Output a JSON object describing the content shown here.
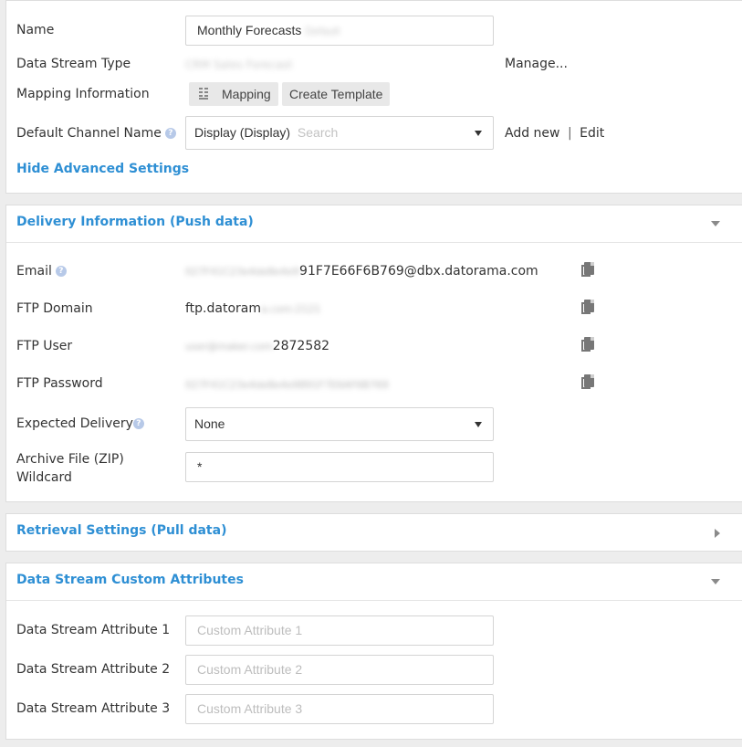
{
  "general": {
    "name_label": "Name",
    "name_value": "Monthly Forecasts",
    "name_value_hidden": "Default",
    "data_stream_type_label": "Data Stream Type",
    "data_stream_type_value": "CRM Sales Forecast",
    "manage_label": "Manage...",
    "mapping_info_label": "Mapping Information",
    "mapping_button": "Mapping",
    "create_template_button": "Create Template",
    "default_channel_label": "Default Channel Name",
    "default_channel_value": "Display (Display)",
    "default_channel_search_placeholder": "Search",
    "add_new_label": "Add new",
    "separator": "|",
    "edit_label": "Edit",
    "hide_advanced_label": "Hide Advanced Settings"
  },
  "delivery": {
    "title": "Delivery Information (Push data)",
    "email_label": "Email",
    "email_hidden": "027F41C23e4de8e4e9",
    "email_visible": "91F7E66F6B769@dbx.datorama.com",
    "ftp_domain_label": "FTP Domain",
    "ftp_domain_visible": "ftp.datoram",
    "ftp_domain_hidden": "a.com:2121",
    "ftp_user_label": "FTP User",
    "ftp_user_hidden": "user@maker.com",
    "ftp_user_visible": "2872582",
    "ftp_password_label": "FTP Password",
    "ftp_password_hidden": "027F41C23e4de8e4e9891F7E6AF6B769",
    "expected_delivery_label": "Expected Delivery",
    "expected_delivery_value": "None",
    "archive_label_line1": "Archive File (ZIP)",
    "archive_label_line2": "Wildcard",
    "archive_value": "*"
  },
  "retrieval": {
    "title": "Retrieval Settings (Pull data)"
  },
  "custom_attributes": {
    "title": "Data Stream Custom Attributes",
    "attr1_label": "Data Stream Attribute 1",
    "attr1_placeholder": "Custom Attribute 1",
    "attr2_label": "Data Stream Attribute 2",
    "attr2_placeholder": "Custom Attribute 2",
    "attr3_label": "Data Stream Attribute 3",
    "attr3_placeholder": "Custom Attribute 3"
  },
  "help_glyph": "?"
}
